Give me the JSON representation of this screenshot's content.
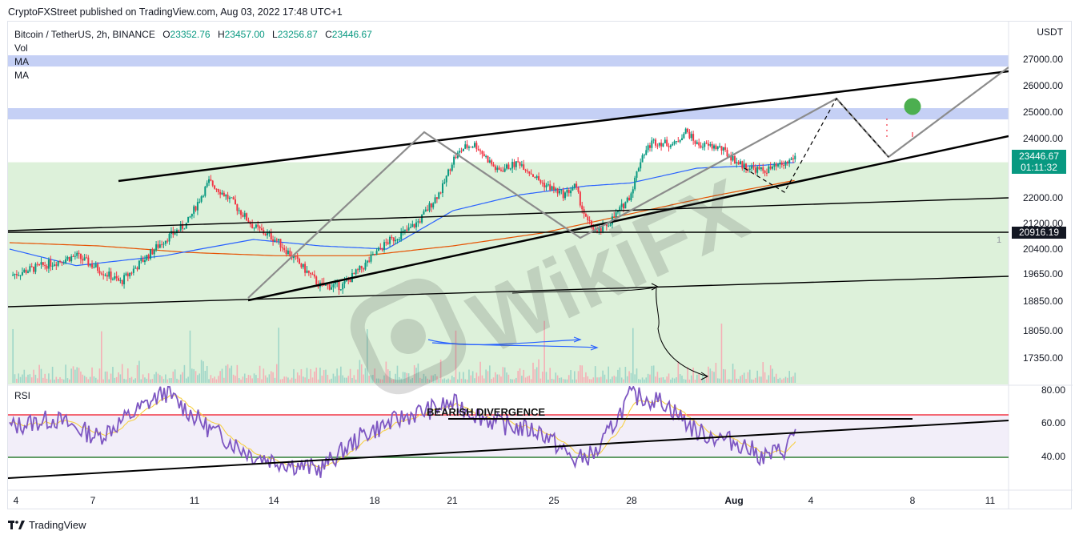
{
  "publish_line": "CryptoFXStreet published on TradingView.com, Aug 03, 2022 17:48 UTC+1",
  "legend": {
    "symbol": "Bitcoin / TetherUS, 2h, BINANCE",
    "o_label": "O",
    "o": "23352.76",
    "h_label": "H",
    "h": "23457.00",
    "l_label": "L",
    "l": "23256.87",
    "c_label": "C",
    "c": "23446.67",
    "vol": "Vol",
    "ma1": "MA",
    "ma2": "MA"
  },
  "price_axis": {
    "currency": "USDT",
    "ticks": [
      "27000.00",
      "26000.00",
      "25000.00",
      "24000.00",
      "22000.00",
      "21200.00",
      "20400.00",
      "19650.00",
      "18850.00",
      "18050.00",
      "17350.00"
    ],
    "last_price": "23446.67",
    "countdown": "01:11:32",
    "line_level": "20916.19",
    "pane_marker": "1"
  },
  "rsi": {
    "label": "RSI",
    "ticks": [
      "80.00",
      "60.00",
      "40.00"
    ],
    "annotation": "BEARISH DIVERGENCE"
  },
  "x_axis": [
    "4",
    "7",
    "11",
    "14",
    "18",
    "21",
    "25",
    "28",
    "Aug",
    "4",
    "8",
    "11"
  ],
  "watermark": "WikiFX",
  "footer": "TradingView",
  "colors": {
    "up": "#089981",
    "down": "#f23645",
    "ma_blue": "#2962ff",
    "ma_red": "#e65100",
    "rsi_line": "#7e57c2",
    "rsi_ma": "#f7d046",
    "zone_green": "#d7efd3",
    "zone_blue": "#c5d0f5",
    "projection_dot": "#4caf50"
  },
  "chart_data": {
    "type": "candlestick",
    "title": "Bitcoin / TetherUS, 2h, BINANCE",
    "ylabel": "USDT",
    "ylim": [
      16900,
      27800
    ],
    "x": [
      "4",
      "7",
      "11",
      "14",
      "18",
      "21",
      "25",
      "28",
      "Aug",
      "4",
      "8",
      "11"
    ],
    "ohlc_last": {
      "open": 23352.76,
      "high": 23457.0,
      "low": 23256.87,
      "close": 23446.67
    },
    "price_path": [
      [
        0,
        19600
      ],
      [
        3,
        20200
      ],
      [
        5,
        19400
      ],
      [
        7,
        20700
      ],
      [
        8,
        21200
      ],
      [
        9,
        22550
      ],
      [
        10,
        21900
      ],
      [
        11,
        21100
      ],
      [
        12,
        20700
      ],
      [
        13,
        20000
      ],
      [
        14,
        19300
      ],
      [
        15,
        19300
      ],
      [
        16,
        19900
      ],
      [
        17,
        20600
      ],
      [
        18,
        21000
      ],
      [
        18.5,
        21300
      ],
      [
        19,
        21800
      ],
      [
        19.5,
        22300
      ],
      [
        20,
        23300
      ],
      [
        20.5,
        23700
      ],
      [
        21,
        23800
      ],
      [
        22,
        22900
      ],
      [
        23,
        23200
      ],
      [
        24,
        22500
      ],
      [
        25,
        22100
      ],
      [
        25.5,
        22400
      ],
      [
        26,
        21300
      ],
      [
        26.5,
        20900
      ],
      [
        27,
        21200
      ],
      [
        27.5,
        21600
      ],
      [
        28,
        22100
      ],
      [
        28.5,
        23400
      ],
      [
        29,
        23900
      ],
      [
        30,
        23800
      ],
      [
        30.5,
        24300
      ],
      [
        31,
        23800
      ],
      [
        32,
        23700
      ],
      [
        33,
        23100
      ],
      [
        34,
        22900
      ],
      [
        35,
        23150
      ],
      [
        35.5,
        23446.67
      ]
    ],
    "ma_blue_path": [
      [
        0,
        20400
      ],
      [
        3,
        19900
      ],
      [
        7,
        20200
      ],
      [
        11,
        20700
      ],
      [
        14,
        20500
      ],
      [
        17,
        20400
      ],
      [
        20,
        21600
      ],
      [
        23,
        22100
      ],
      [
        26,
        22400
      ],
      [
        28,
        22500
      ],
      [
        31,
        23000
      ],
      [
        34,
        23100
      ],
      [
        35.5,
        23200
      ]
    ],
    "ma_red_path": [
      [
        0,
        20600
      ],
      [
        4,
        20500
      ],
      [
        8,
        20300
      ],
      [
        12,
        20200
      ],
      [
        16,
        20200
      ],
      [
        20,
        20500
      ],
      [
        24,
        20900
      ],
      [
        28,
        21500
      ],
      [
        32,
        22100
      ],
      [
        35.5,
        22600
      ]
    ],
    "rsi_path": [
      [
        0,
        58
      ],
      [
        2,
        63
      ],
      [
        4,
        52
      ],
      [
        7,
        79
      ],
      [
        9,
        57
      ],
      [
        11,
        41
      ],
      [
        13,
        35
      ],
      [
        14,
        33
      ],
      [
        16,
        54
      ],
      [
        18,
        65
      ],
      [
        20,
        72
      ],
      [
        22,
        60
      ],
      [
        24,
        55
      ],
      [
        25.5,
        38
      ],
      [
        26.5,
        43
      ],
      [
        28,
        77
      ],
      [
        29.5,
        73
      ],
      [
        31,
        55
      ],
      [
        33,
        48
      ],
      [
        34,
        40
      ],
      [
        35,
        45
      ],
      [
        35.5,
        58
      ]
    ],
    "zones": [
      {
        "from": 26900,
        "to": 27150,
        "color": "blue"
      },
      {
        "from": 24900,
        "to": 25150,
        "color": "blue"
      },
      {
        "from": 16900,
        "to": 23200,
        "color": "green"
      }
    ],
    "rsi_levels": [
      70,
      40
    ]
  }
}
